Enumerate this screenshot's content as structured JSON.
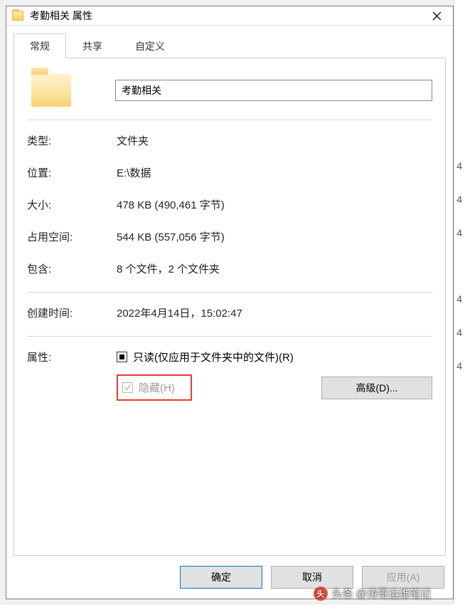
{
  "window": {
    "title": "考勤相关 属性"
  },
  "tabs": {
    "general": "常规",
    "share": "共享",
    "custom": "自定义"
  },
  "folder": {
    "name_value": "考勤相关"
  },
  "labels": {
    "type": "类型:",
    "location": "位置:",
    "size": "大小:",
    "size_on_disk": "占用空间:",
    "contains": "包含:",
    "created": "创建时间:",
    "attributes": "属性:"
  },
  "values": {
    "type": "文件夹",
    "location": "E:\\数据",
    "size": "478 KB (490,461 字节)",
    "size_on_disk": "544 KB (557,056 字节)",
    "contains": "8 个文件，2 个文件夹",
    "created": "2022年4月14日，15:02:47"
  },
  "attributes": {
    "readonly_label": "只读(仅应用于文件夹中的文件)(R)",
    "hidden_label": "隐藏(H)",
    "advanced_label": "高级(D)..."
  },
  "buttons": {
    "ok": "确定",
    "cancel": "取消",
    "apply": "应用(A)"
  },
  "watermark": {
    "text": "头条 @涛哥运维笔记"
  },
  "bg_col": {
    "r1": "4",
    "r2": "4",
    "r3": "4",
    "r4": "4",
    "r5": "4",
    "r6": "4"
  }
}
